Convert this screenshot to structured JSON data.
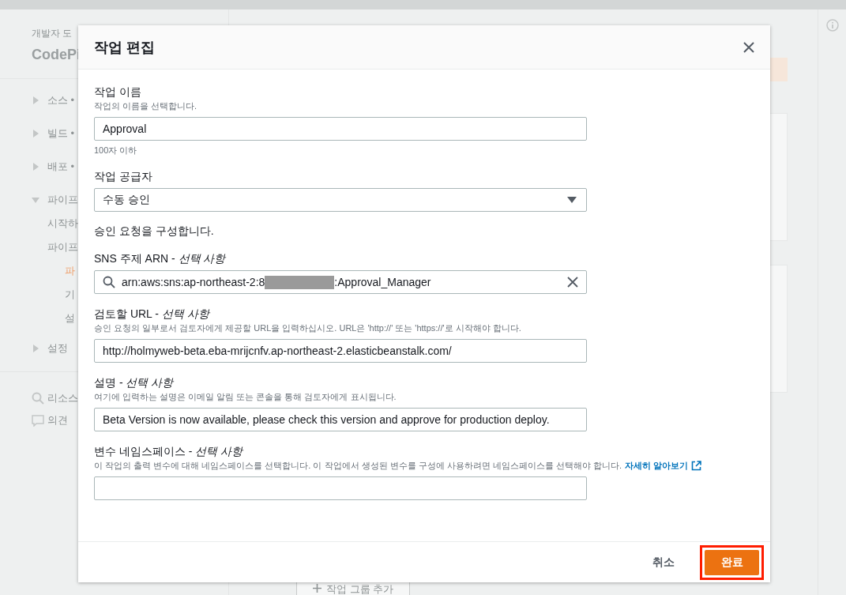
{
  "background": {
    "breadcrumb": "개발자 도",
    "title": "CodePi",
    "nav": [
      {
        "label": "소스 •",
        "expanded": false
      },
      {
        "label": "빌드 •",
        "expanded": false
      },
      {
        "label": "배포 •",
        "expanded": false
      },
      {
        "label": "파이프",
        "expanded": true,
        "children": [
          {
            "label": "시작하",
            "selected": false
          },
          {
            "label": "파이프",
            "selected": false,
            "children": [
              {
                "label": "파",
                "selected": true
              },
              {
                "label": "기",
                "selected": false
              },
              {
                "label": "설",
                "selected": false
              }
            ]
          }
        ]
      },
      {
        "label": "설정",
        "expanded": false
      }
    ],
    "links": [
      {
        "label": "리소스",
        "kind": "search"
      },
      {
        "label": "의견",
        "kind": "feedback"
      }
    ],
    "add_button": "작업 그룹 추가"
  },
  "modal": {
    "title": "작업 편집",
    "fields": [
      {
        "kind": "text",
        "label": "작업 이름",
        "description": "작업의 이름을 선택합니다.",
        "value": "Approval",
        "constraint": "100자 이하"
      },
      {
        "kind": "select",
        "label": "작업 공급자",
        "value": "수동 승인"
      },
      {
        "kind": "note",
        "text": "승인 요청을 구성합니다."
      },
      {
        "kind": "search",
        "label": "SNS 주제 ARN - *선택 사항*",
        "value_before": "arn:aws:sns:ap-northeast-2:8",
        "value_after": ":Approval_Manager",
        "redacted": true
      },
      {
        "kind": "text",
        "label": "검토할 URL - *선택 사항*",
        "description": "승인 요청의 일부로서 검토자에게 제공할 URL을 입력하십시오. URL은 'http://' 또는 'https://'로 시작해야 합니다.",
        "value": "http://holmyweb-beta.eba-mrijcnfv.ap-northeast-2.elasticbeanstalk.com/"
      },
      {
        "kind": "text",
        "label": "설명 - *선택 사항*",
        "description": "여기에 입력하는 설명은 이메일 알림 또는 콘솔을 통해 검토자에게 표시됩니다.",
        "value": "Beta Version is now available, please check this version and approve for production deploy."
      },
      {
        "kind": "text",
        "label": "변수 네임스페이스 - *선택 사항*",
        "description": "이 작업의 출력 변수에 대해 네임스페이스를 선택합니다. 이 작업에서 생성된 변수를 구성에 사용하려면 네임스페이스를 선택해야 합니다.",
        "link": "자세히 알아보기"
      }
    ],
    "cancel": "취소",
    "confirm": "완료",
    "confirm_highlighted": true
  }
}
